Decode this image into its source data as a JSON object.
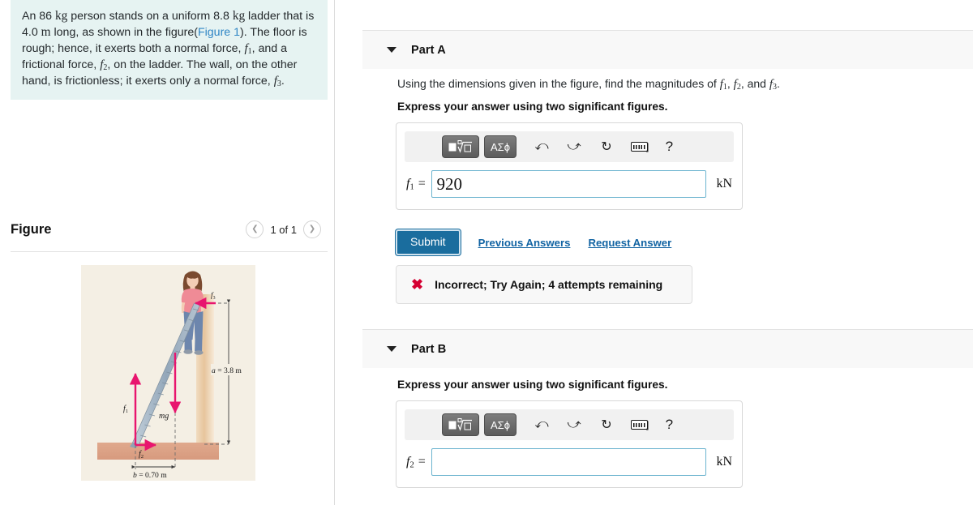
{
  "problem": {
    "lines": [
      "An 86 kg person stands on a uniform 8.8 kg ladder that is",
      "4.0 m long, as shown in the figure(Figure 1). The floor is",
      "rough; hence, it exerts both a normal force, f₁, and a",
      "frictional force, f₂, on the ladder. The wall, on the other",
      "hand, is frictionless; it exerts only a normal force, f₃."
    ],
    "figure_link_text": "Figure 1",
    "mass_person": "86 kg",
    "mass_ladder": "8.8 kg",
    "ladder_length": "4.0 m"
  },
  "figure_panel": {
    "title": "Figure",
    "pager": {
      "prev_icon": "chevron-left-icon",
      "label": "1 of 1",
      "next_icon": "chevron-right-icon"
    }
  },
  "figure_diagram": {
    "labels": {
      "f1": "f₁",
      "f2": "f₂",
      "f3": "f₃",
      "mg": "mg",
      "height_dim": "a = 3.8 m",
      "base_dim": "b = 0.70 m"
    },
    "colors": {
      "background": "#f4efe4",
      "arrow": "#e8156e",
      "wall": "#e3b98a",
      "floor": "#dda98c",
      "ladder": "#9fb2c4",
      "shirt": "#ef8b96",
      "jeans": "#6d86ad",
      "hair": "#7a4a2f",
      "dimension_line": "#4a4a4a"
    }
  },
  "parts": [
    {
      "id": "part-a",
      "caret_icon": "caret-down-icon",
      "title": "Part A",
      "question": "Using the dimensions given in the figure, find the magnitudes of f₁, f₂, and f₃.",
      "instruction": "Express your answer using two significant figures.",
      "answer": {
        "label": "f₁ =",
        "value": "920",
        "placeholder": "",
        "unit": "kN"
      },
      "toolbar": {
        "template_button": "square-root-template-icon",
        "symbols_button": "ΑΣϕ",
        "undo_icon": "undo-arrow-icon",
        "redo_icon": "redo-arrow-icon",
        "reset_icon": "reset-circular-arrow-icon",
        "keyboard_icon": "keyboard-icon",
        "keyboard_suffix": "]",
        "help_icon": "?"
      },
      "actions": {
        "submit_label": "Submit",
        "previous_answers_label": "Previous Answers",
        "request_answer_label": "Request Answer"
      },
      "feedback": {
        "icon": "error-x-icon",
        "text": "Incorrect; Try Again; 4 attempts remaining",
        "color": "#d50032"
      }
    },
    {
      "id": "part-b",
      "caret_icon": "caret-down-icon",
      "title": "Part B",
      "question": "",
      "instruction": "Express your answer using two significant figures.",
      "answer": {
        "label": "f₂ =",
        "value": "",
        "placeholder": "",
        "unit": "kN"
      },
      "toolbar": {
        "template_button": "square-root-template-icon",
        "symbols_button": "ΑΣϕ",
        "undo_icon": "undo-arrow-icon",
        "redo_icon": "redo-arrow-icon",
        "reset_icon": "reset-circular-arrow-icon",
        "keyboard_icon": "keyboard-icon",
        "keyboard_suffix": "]",
        "help_icon": "?"
      }
    }
  ],
  "theme": {
    "problem_bg": "#e6f3f2",
    "part_header_bg": "#f8f8f8",
    "submit_blue": "#1a6d9e",
    "link_blue": "#1264a3",
    "input_border": "#6cb4cf"
  }
}
